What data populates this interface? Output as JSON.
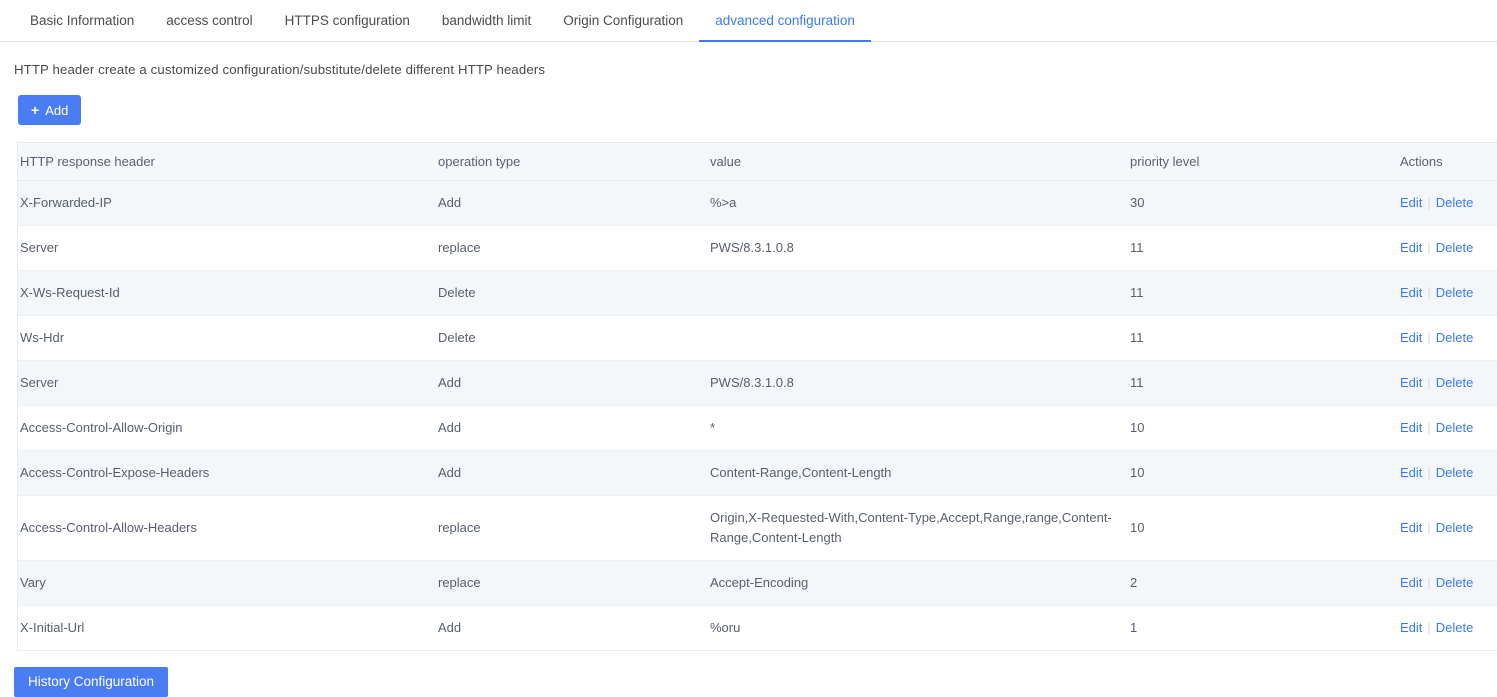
{
  "tabs": [
    {
      "label": "Basic Information",
      "active": false
    },
    {
      "label": "access control",
      "active": false
    },
    {
      "label": "HTTPS configuration",
      "active": false
    },
    {
      "label": "bandwidth limit",
      "active": false
    },
    {
      "label": "Origin Configuration",
      "active": false
    },
    {
      "label": "advanced configuration",
      "active": true
    }
  ],
  "description": "HTTP header create a customized configuration/substitute/delete different HTTP headers",
  "toolbar": {
    "add_label": "Add",
    "add_icon": "plus-icon"
  },
  "table": {
    "columns": [
      "HTTP response header",
      "operation type",
      "value",
      "priority level",
      "Actions"
    ],
    "row_actions": {
      "edit_label": "Edit",
      "delete_label": "Delete",
      "separator": "|"
    },
    "rows": [
      {
        "header": "X-Forwarded-IP",
        "operation": "Add",
        "value": "%>a",
        "priority": "30"
      },
      {
        "header": "Server",
        "operation": "replace",
        "value": "PWS/8.3.1.0.8",
        "priority": "11"
      },
      {
        "header": "X-Ws-Request-Id",
        "operation": "Delete",
        "value": "",
        "priority": "11"
      },
      {
        "header": "Ws-Hdr",
        "operation": "Delete",
        "value": "",
        "priority": "11"
      },
      {
        "header": "Server",
        "operation": "Add",
        "value": "PWS/8.3.1.0.8",
        "priority": "11"
      },
      {
        "header": "Access-Control-Allow-Origin",
        "operation": "Add",
        "value": "*",
        "priority": "10"
      },
      {
        "header": "Access-Control-Expose-Headers",
        "operation": "Add",
        "value": "Content-Range,Content-Length",
        "priority": "10"
      },
      {
        "header": "Access-Control-Allow-Headers",
        "operation": "replace",
        "value": "Origin,X-Requested-With,Content-Type,Accept,Range,range,Content-Range,Content-Length",
        "priority": "10"
      },
      {
        "header": "Vary",
        "operation": "replace",
        "value": "Accept-Encoding",
        "priority": "2"
      },
      {
        "header": "X-Initial-Url",
        "operation": "Add",
        "value": "%oru",
        "priority": "1"
      }
    ]
  },
  "footer": {
    "history_label": "History Configuration"
  },
  "colors": {
    "accent": "#3a7bf0",
    "button": "#4a7cf3",
    "header_row": "#f5f7fa",
    "stripe_row": "#f4f7fa",
    "border": "#e6ebf0",
    "text": "#585f6b"
  }
}
